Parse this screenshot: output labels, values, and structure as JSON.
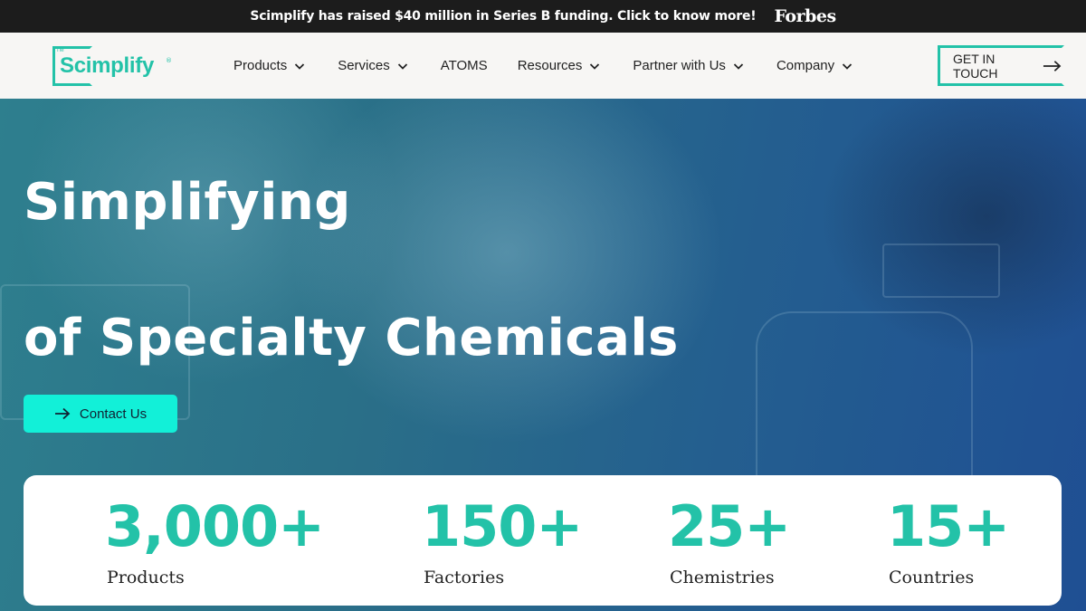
{
  "announcement": {
    "text": "Scimplify has raised $40 million in Series B funding. Click to know more!",
    "badge": "Forbes"
  },
  "header": {
    "logo_text": "Scimplify",
    "nav": [
      {
        "label": "Products",
        "has_dropdown": true
      },
      {
        "label": "Services",
        "has_dropdown": true
      },
      {
        "label": "ATOMS",
        "has_dropdown": false
      },
      {
        "label": "Resources",
        "has_dropdown": true
      },
      {
        "label": "Partner with Us",
        "has_dropdown": true
      },
      {
        "label": "Company",
        "has_dropdown": true
      }
    ],
    "cta_label": "GET IN TOUCH"
  },
  "hero": {
    "title_line1": "Simplifying",
    "title_line2": "of Specialty Chemicals",
    "contact_label": "Contact Us"
  },
  "stats": [
    {
      "value": "3,000+",
      "label": "Products"
    },
    {
      "value": "150+",
      "label": "Factories"
    },
    {
      "value": "25+",
      "label": "Chemistries"
    },
    {
      "value": "15+",
      "label": "Countries"
    }
  ],
  "colors": {
    "accent": "#23c2a8",
    "button": "#12f0d8",
    "announce_bg": "#1c1c1c",
    "header_bg": "#f7f6f4"
  }
}
